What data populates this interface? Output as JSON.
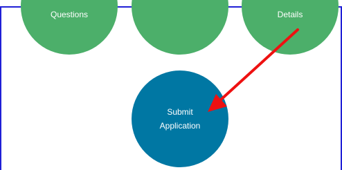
{
  "steps": [
    {
      "label": "Questions",
      "status": "completed"
    },
    {
      "label": "",
      "status": "completed"
    },
    {
      "label": "Details",
      "status": "completed"
    },
    {
      "label": "Submit Application",
      "status": "current"
    }
  ],
  "colors": {
    "completed": "#4caf6a",
    "current": "#0077a3",
    "frame_border": "#1f1fd6",
    "annotation_arrow": "#ee1111"
  },
  "annotation": {
    "icon": "red-arrow-icon",
    "points_to": "Submit Application"
  }
}
